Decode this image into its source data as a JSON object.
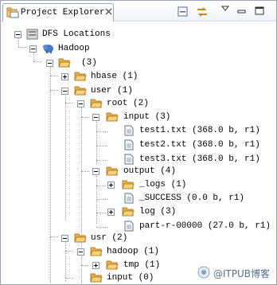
{
  "view": {
    "tab_title": "Project Explorer",
    "toolbar": {
      "collapse_all": "collapse-all",
      "link_with_editor": "link-with-editor",
      "view_menu": "view-menu",
      "minimize": "minimize",
      "maximize": "maximize"
    }
  },
  "tree": {
    "dfs_locations": "DFS Locations",
    "hadoop": "Hadoop",
    "root_dir": "(3)",
    "hbase": "hbase (1)",
    "user": "user (1)",
    "root": "root (2)",
    "input": "input (3)",
    "test1": "test1.txt (368.0 b, r1)",
    "test2": "test2.txt (368.0 b, r1)",
    "test3": "test3.txt (368.0 b, r1)",
    "output": "output (4)",
    "logs": "_logs (1)",
    "success": "_SUCCESS (0.0 b, r1)",
    "log": "log (3)",
    "part": "part-r-00000 (27.0 b, r1)",
    "usr": "usr (2)",
    "hadoop_dir": "hadoop (1)",
    "tmp": "tmp (1)",
    "input_usr": "input (0)"
  },
  "watermark": "@ITPUB博客",
  "colors": {
    "folder": "#e8b04a",
    "folder_dark": "#b8802a",
    "file": "#ffffff",
    "border": "#9aa6b8"
  }
}
